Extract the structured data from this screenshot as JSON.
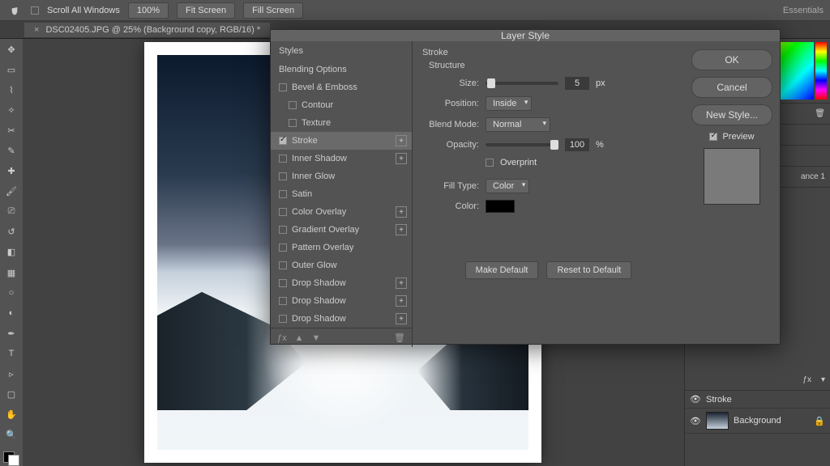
{
  "topbar": {
    "scroll_label": "Scroll All Windows",
    "zoom": "100%",
    "fit": "Fit Screen",
    "fill": "Fill Screen",
    "workspace": "Essentials"
  },
  "document": {
    "tab_title": "DSC02405.JPG @ 25% (Background copy, RGB/16) *"
  },
  "dialog": {
    "title": "Layer Style",
    "styles_head": "Styles",
    "blending": "Blending Options",
    "effects": [
      {
        "label": "Bevel & Emboss",
        "checked": false,
        "plus": false,
        "indent": false
      },
      {
        "label": "Contour",
        "checked": false,
        "plus": false,
        "indent": true
      },
      {
        "label": "Texture",
        "checked": false,
        "plus": false,
        "indent": true
      },
      {
        "label": "Stroke",
        "checked": true,
        "plus": true,
        "indent": false,
        "selected": true
      },
      {
        "label": "Inner Shadow",
        "checked": false,
        "plus": true,
        "indent": false
      },
      {
        "label": "Inner Glow",
        "checked": false,
        "plus": false,
        "indent": false
      },
      {
        "label": "Satin",
        "checked": false,
        "plus": false,
        "indent": false
      },
      {
        "label": "Color Overlay",
        "checked": false,
        "plus": true,
        "indent": false
      },
      {
        "label": "Gradient Overlay",
        "checked": false,
        "plus": true,
        "indent": false
      },
      {
        "label": "Pattern Overlay",
        "checked": false,
        "plus": false,
        "indent": false
      },
      {
        "label": "Outer Glow",
        "checked": false,
        "plus": false,
        "indent": false
      },
      {
        "label": "Drop Shadow",
        "checked": false,
        "plus": true,
        "indent": false
      },
      {
        "label": "Drop Shadow",
        "checked": false,
        "plus": true,
        "indent": false
      },
      {
        "label": "Drop Shadow",
        "checked": false,
        "plus": true,
        "indent": false
      }
    ],
    "stroke": {
      "section": "Stroke",
      "structure": "Structure",
      "size_label": "Size:",
      "size_value": "5",
      "size_unit": "px",
      "position_label": "Position:",
      "position_value": "Inside",
      "blend_label": "Blend Mode:",
      "blend_value": "Normal",
      "opacity_label": "Opacity:",
      "opacity_value": "100",
      "opacity_unit": "%",
      "overprint_label": "Overprint",
      "fill_type_label": "Fill Type:",
      "fill_type_value": "Color",
      "color_label": "Color:",
      "make_default": "Make Default",
      "reset_default": "Reset to Default"
    },
    "buttons": {
      "ok": "OK",
      "cancel": "Cancel",
      "new_style": "New Style...",
      "preview": "Preview"
    }
  },
  "layers": {
    "stroke_fx": "Stroke",
    "bg": "Background",
    "ance": "ance 1"
  }
}
